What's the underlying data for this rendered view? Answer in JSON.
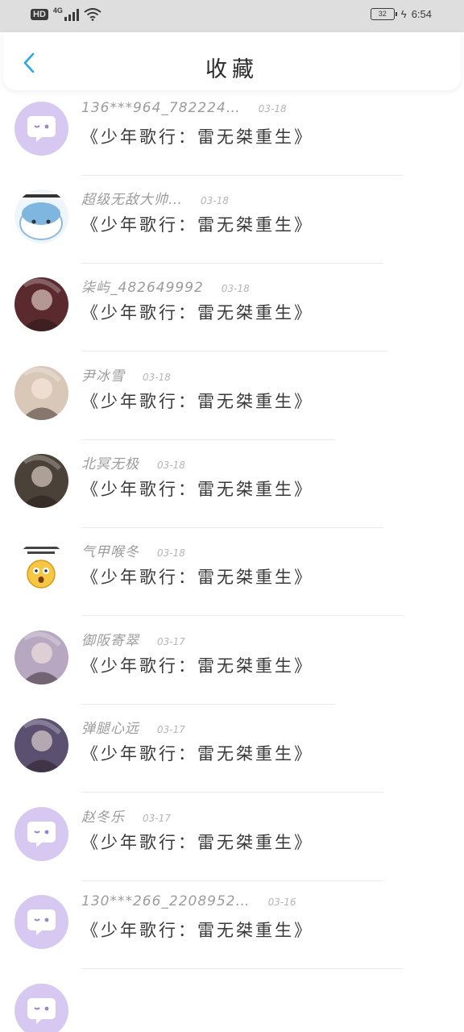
{
  "status_bar": {
    "hd": "HD",
    "network": "4G",
    "battery": "32",
    "time": "6:54"
  },
  "header": {
    "title": "收藏",
    "back_icon": "chevron-left-icon",
    "back_color": "#2aa8e6"
  },
  "favorites": [
    {
      "name": "",
      "date": "",
      "title": "《少年歌行：雷无桀重生》",
      "avatar": "photo-avatar",
      "avatar_color": "#a0524a"
    },
    {
      "name": "136***964_782224…",
      "date": "03-18",
      "title": "《少年歌行：雷无桀重生》",
      "avatar": "chat-bubble-icon",
      "avatar_color": "#d7c8f2"
    },
    {
      "name": "超级无敌大帅…",
      "date": "03-18",
      "title": "《少年歌行：雷无桀重生》",
      "avatar": "sticker-avatar",
      "avatar_color": "#eef6fb"
    },
    {
      "name": "柒屿_482649992",
      "date": "03-18",
      "title": "《少年歌行：雷无桀重生》",
      "avatar": "photo-avatar",
      "avatar_color": "#5a2a2e"
    },
    {
      "name": "尹冰雪",
      "date": "03-18",
      "title": "《少年歌行：雷无桀重生》",
      "avatar": "photo-avatar",
      "avatar_color": "#d9c7b8"
    },
    {
      "name": "北冥无极",
      "date": "03-18",
      "title": "《少年歌行：雷无桀重生》",
      "avatar": "photo-avatar",
      "avatar_color": "#4a4238"
    },
    {
      "name": "气甲喉冬",
      "date": "03-18",
      "title": "《少年歌行：雷无桀重生》",
      "avatar": "emoji-avatar",
      "avatar_color": "#f6c744"
    },
    {
      "name": "御阪寄翠",
      "date": "03-17",
      "title": "《少年歌行：雷无桀重生》",
      "avatar": "photo-avatar",
      "avatar_color": "#b7a7c0"
    },
    {
      "name": "弹腿心远",
      "date": "03-17",
      "title": "《少年歌行：雷无桀重生》",
      "avatar": "photo-avatar",
      "avatar_color": "#5b5070"
    },
    {
      "name": "赵冬乐",
      "date": "03-17",
      "title": "《少年歌行：雷无桀重生》",
      "avatar": "chat-bubble-icon",
      "avatar_color": "#d7c8f2"
    },
    {
      "name": "130***266_2208952…",
      "date": "03-16",
      "title": "《少年歌行：雷无桀重生》",
      "avatar": "chat-bubble-icon",
      "avatar_color": "#d7c8f2"
    },
    {
      "name": "",
      "date": "",
      "title": "",
      "avatar": "chat-bubble-icon",
      "avatar_color": "#d7c8f2"
    }
  ]
}
